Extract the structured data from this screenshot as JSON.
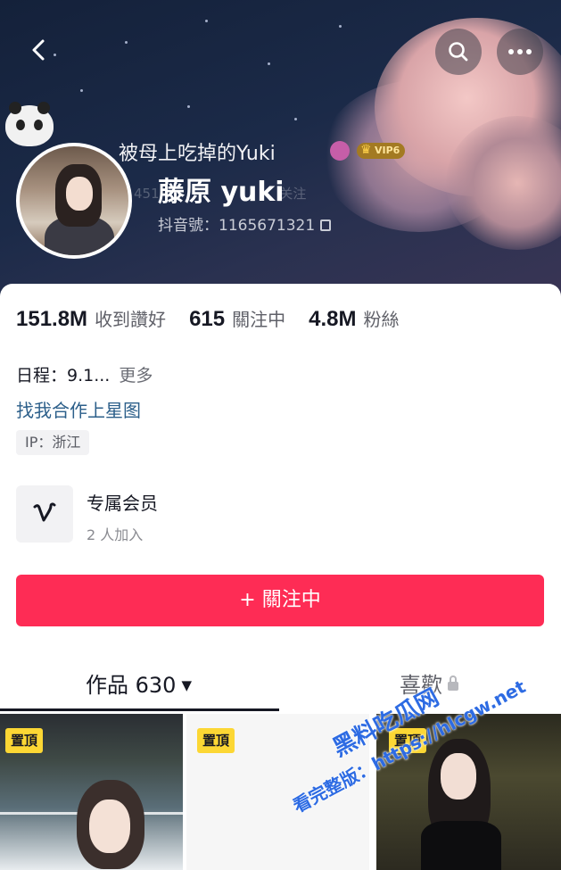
{
  "header": {
    "nickname_top": "被母上吃掉的Yuki",
    "vip_label": "VIP6",
    "fans_hint": "451",
    "fans_hint_suffix": "关注",
    "display_name": "藤原 yuki",
    "douyin_id": "抖音號：1165671321"
  },
  "icons": {
    "back": "chevron-left-icon",
    "search": "search-icon",
    "more": "more-dots-icon",
    "copy": "copy-icon"
  },
  "stats": [
    {
      "value": "151.8M",
      "label": "收到讚好"
    },
    {
      "value": "615",
      "label": "關注中"
    },
    {
      "value": "4.8M",
      "label": "粉絲"
    }
  ],
  "bio": {
    "text": "日程：9.1...",
    "more": "更多",
    "star_link": "找我合作上星图",
    "ip": "IP：浙江"
  },
  "member": {
    "title": "专属会员",
    "subtitle": "2 人加入"
  },
  "follow_button": "+ 關注中",
  "tabs": {
    "works": "作品 630",
    "likes": "喜歡"
  },
  "thumbnails": [
    {
      "pin": "置頂"
    },
    {
      "pin": "置頂"
    },
    {
      "pin": "置頂"
    }
  ],
  "watermark": {
    "line1": "黑料吃瓜网",
    "line2": "看完整版：https://hlcgw.net"
  },
  "colors": {
    "accent": "#fe2c55",
    "link": "#2c5f8a",
    "pin": "#fcd734",
    "watermark": "#2d6be3"
  }
}
